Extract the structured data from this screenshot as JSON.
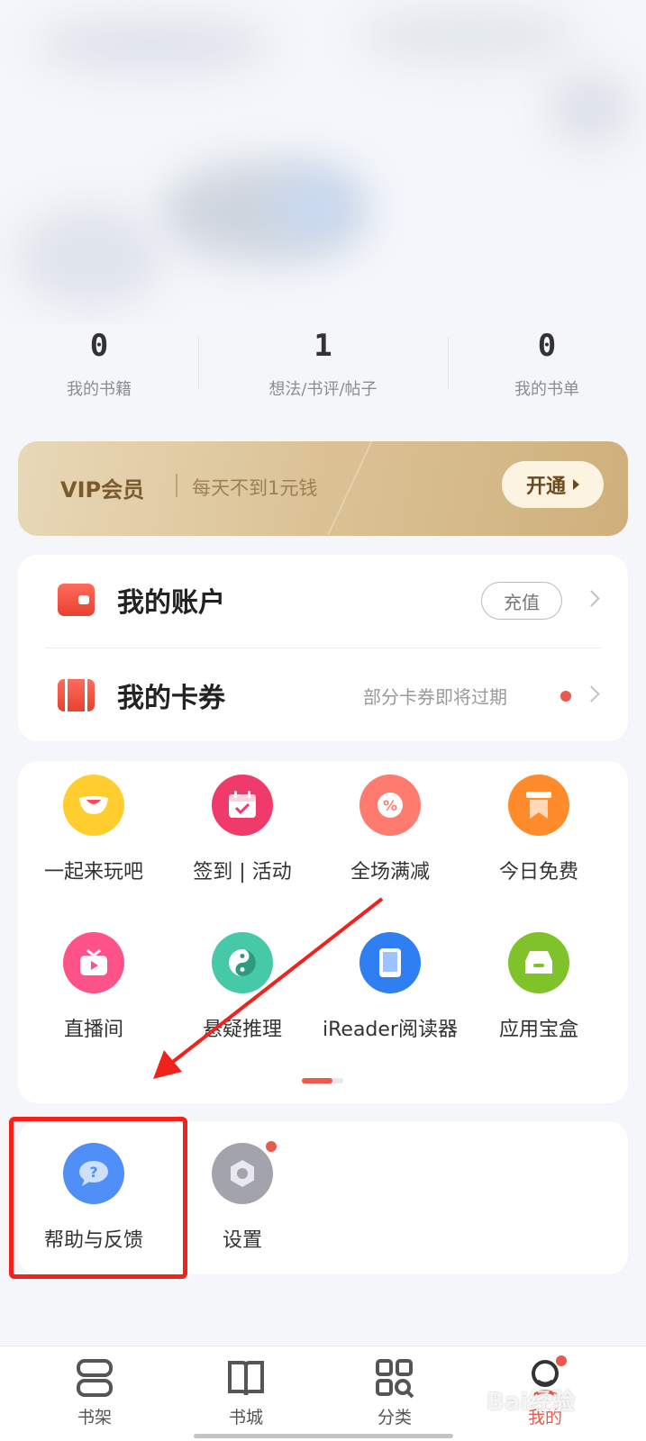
{
  "stats": [
    {
      "value": "0",
      "label": "我的书籍"
    },
    {
      "value": "1",
      "label": "想法/书评/帖子"
    },
    {
      "value": "0",
      "label": "我的书单"
    }
  ],
  "vip": {
    "title": "VIP会员",
    "desc": "每天不到1元钱",
    "button": "开通"
  },
  "account": {
    "label": "我的账户",
    "recharge": "充值"
  },
  "coupons": {
    "label": "我的卡券",
    "hint": "部分卡券即将过期"
  },
  "grid": [
    {
      "label": "一起来玩吧",
      "icon": "smile-icon",
      "color": "#ffce2e"
    },
    {
      "label": "签到 | 活动",
      "icon": "calendar-check-icon",
      "color": "#f03a6b"
    },
    {
      "label": "全场满减",
      "icon": "discount-badge-icon",
      "color": "#ff7a6f"
    },
    {
      "label": "今日免费",
      "icon": "bookmark-icon",
      "color": "#ff8b2b"
    },
    {
      "label": "直播间",
      "icon": "tv-icon",
      "color": "#ff5288"
    },
    {
      "label": "悬疑推理",
      "icon": "yin-yang-icon",
      "color": "#45c9a6"
    },
    {
      "label": "iReader阅读器",
      "icon": "tablet-icon",
      "color": "#2f7ff2"
    },
    {
      "label": "应用宝盒",
      "icon": "tray-icon",
      "color": "#7fc22a"
    }
  ],
  "tools": [
    {
      "label": "帮助与反馈",
      "icon": "help-chat-icon",
      "color": "#4f8ff7"
    },
    {
      "label": "设置",
      "icon": "gear-icon",
      "color": "#a3a3ad"
    }
  ],
  "tabs": [
    {
      "label": "书架",
      "icon": "bookshelf-icon",
      "active": false
    },
    {
      "label": "书城",
      "icon": "book-open-icon",
      "active": false
    },
    {
      "label": "分类",
      "icon": "category-grid-icon",
      "active": false
    },
    {
      "label": "我的",
      "icon": "profile-icon",
      "active": true
    }
  ],
  "watermark": "Bai经验",
  "colors": {
    "accent": "#e85a4c",
    "highlight": "#f1211b"
  }
}
